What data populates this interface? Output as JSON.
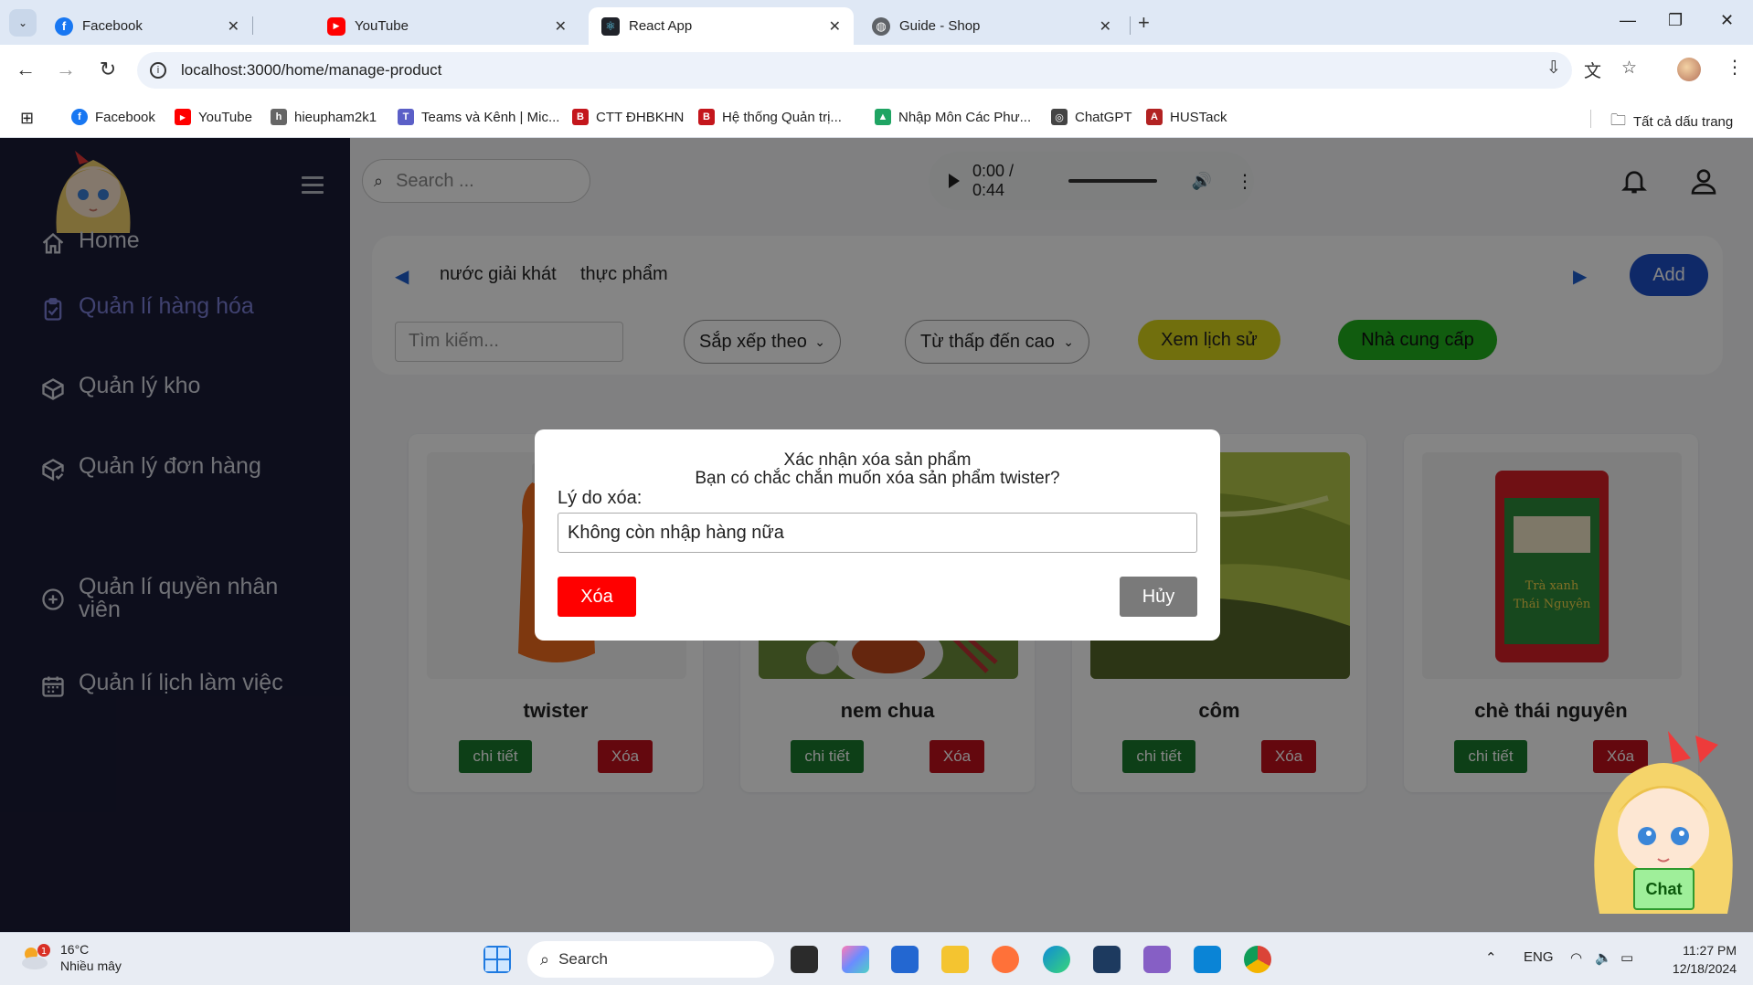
{
  "browser": {
    "tabs": [
      {
        "label": "Facebook",
        "icon": "facebook-icon",
        "color": "#1877f2",
        "glyph": "f"
      },
      {
        "label": "YouTube",
        "icon": "youtube-icon",
        "color": "#ff0000",
        "glyph": "▶"
      },
      {
        "label": "React App",
        "icon": "react-icon",
        "color": "#20232a",
        "glyph": "⚛"
      },
      {
        "label": "Guide - Shop",
        "icon": "globe-icon",
        "color": "#5f6368",
        "glyph": "◍"
      }
    ],
    "url": "localhost:3000/home/manage-product",
    "bookmarks": [
      {
        "label": "Facebook",
        "color": "#1877f2",
        "glyph": "f"
      },
      {
        "label": "YouTube",
        "color": "#ff0000",
        "glyph": "▶"
      },
      {
        "label": "hieupham2k1",
        "color": "#666",
        "glyph": "h"
      },
      {
        "label": "Teams và Kênh | Mic...",
        "color": "#5b5fc7",
        "glyph": "T"
      },
      {
        "label": "CTT ĐHBKHN",
        "color": "#c4161c",
        "glyph": "B"
      },
      {
        "label": "Hệ thống Quản trị...",
        "color": "#c4161c",
        "glyph": "B"
      },
      {
        "label": "Nhập Môn Các Phư...",
        "color": "#1fa463",
        "glyph": "▲"
      },
      {
        "label": "ChatGPT",
        "color": "#444",
        "glyph": "◎"
      },
      {
        "label": "HUSTack",
        "color": "#b22222",
        "glyph": "A"
      }
    ],
    "all_bookmarks": "Tất cả dấu trang"
  },
  "sidebar": {
    "items": [
      {
        "label": "Home",
        "icon": "home-icon"
      },
      {
        "label": "Quản lí hàng hóa",
        "icon": "clipboard-icon",
        "active": true
      },
      {
        "label": "Quản lý kho",
        "icon": "box-icon"
      },
      {
        "label": "Quản lý đơn hàng",
        "icon": "box-check-icon"
      },
      {
        "label": "Quản lí quyền nhân viên",
        "icon": "plus-circle-icon"
      },
      {
        "label": "Quản lí lịch làm việc",
        "icon": "calendar-icon"
      }
    ]
  },
  "topbar": {
    "search_placeholder": "Search ...",
    "audio_time": "0:00 / 0:44"
  },
  "filters": {
    "categories": [
      "nước giải khát",
      "thực phẩm"
    ],
    "add_label": "Add",
    "search_placeholder": "Tìm kiếm...",
    "sort_label": "Sắp xếp theo",
    "order_label": "Từ thấp đến cao",
    "history_label": "Xem lịch sử",
    "supplier_label": "Nhà cung cấp"
  },
  "products": [
    {
      "name": "twister",
      "detail": "chi tiết",
      "delete": "Xóa"
    },
    {
      "name": "nem chua",
      "detail": "chi tiết",
      "delete": "Xóa"
    },
    {
      "name": "côm",
      "detail": "chi tiết",
      "delete": "Xóa"
    },
    {
      "name": "chè thái nguyên",
      "detail": "chi tiết",
      "delete": "Xóa"
    }
  ],
  "modal": {
    "title": "Xác nhận xóa sản phẩm",
    "question": "Bạn có chắc chắn muốn xóa sản phẩm twister?",
    "reason_label": "Lý do xóa:",
    "reason_value": "Không còn nhập hàng nữa",
    "confirm_label": "Xóa",
    "cancel_label": "Hủy"
  },
  "chat_label": "Chat",
  "taskbar": {
    "weather_temp": "16°C",
    "weather_desc": "Nhiều mây",
    "weather_badge": "1",
    "search_label": "Search",
    "lang": "ENG",
    "time": "11:27 PM",
    "date": "12/18/2024"
  },
  "colors": {
    "sidebar_bg": "#1a1b36",
    "active_item": "#7b7fd6",
    "add_button": "#1e4fc8",
    "history_pill": "#d9d51a",
    "supplier_pill": "#22b01e",
    "detail_button": "#1a7a2c",
    "delete_button": "#c0111b",
    "modal_delete": "#ff0000",
    "modal_cancel": "#7a7a7a"
  }
}
